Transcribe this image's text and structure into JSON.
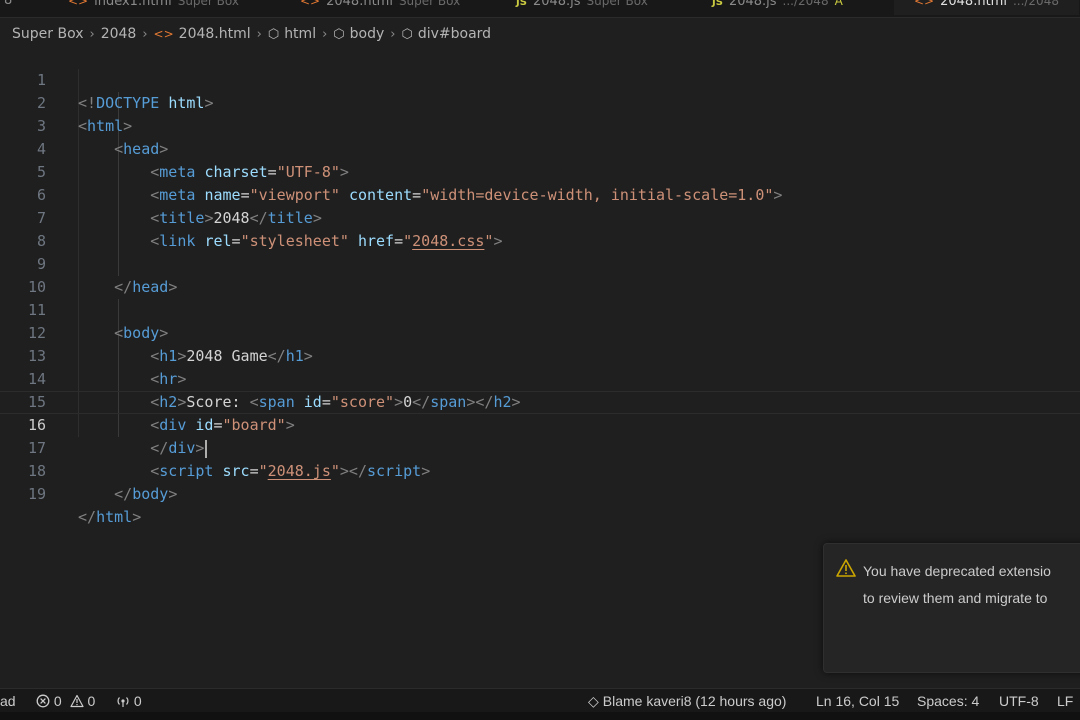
{
  "tabs": [
    {
      "label": "index1.html",
      "desc": "Super Box",
      "icon": "html-file-icon"
    },
    {
      "label": "2048.html",
      "desc": "Super Box",
      "icon": "html-file-icon"
    },
    {
      "label": "2048.js",
      "desc": "Super Box",
      "icon": "js-file-icon"
    },
    {
      "label": "2048.js",
      "desc": ".../2048",
      "marker": "A",
      "icon": "js-file-icon"
    },
    {
      "label": "2048.html",
      "desc": ".../2048",
      "icon": "html-file-icon"
    }
  ],
  "breadcrumb": [
    "Super Box",
    "2048",
    "2048.html",
    "html",
    "body",
    "div#board"
  ],
  "editor": {
    "current_line": 16,
    "line_numbers": [
      "1",
      "2",
      "3",
      "4",
      "5",
      "6",
      "7",
      "8",
      "9",
      "10",
      "11",
      "12",
      "13",
      "14",
      "15",
      "16",
      "17",
      "18",
      "19"
    ]
  },
  "notification": {
    "line1": "You have deprecated extensio",
    "line2": "to review them and migrate to"
  },
  "status": {
    "mode_fragment": "ad",
    "errors": "0",
    "warnings": "0",
    "ports": "0",
    "blame": "Blame kaveri8 (12 hours ago)",
    "position": "Ln 16, Col 15",
    "spaces": "Spaces: 4",
    "encoding": "UTF-8",
    "eol": "LF"
  },
  "colors": {
    "tag": "#569cd6",
    "attribute": "#9cdcfe",
    "string": "#ce9178",
    "bracket": "#808080",
    "text": "#d4d4d4",
    "background": "#1f1f1f"
  }
}
